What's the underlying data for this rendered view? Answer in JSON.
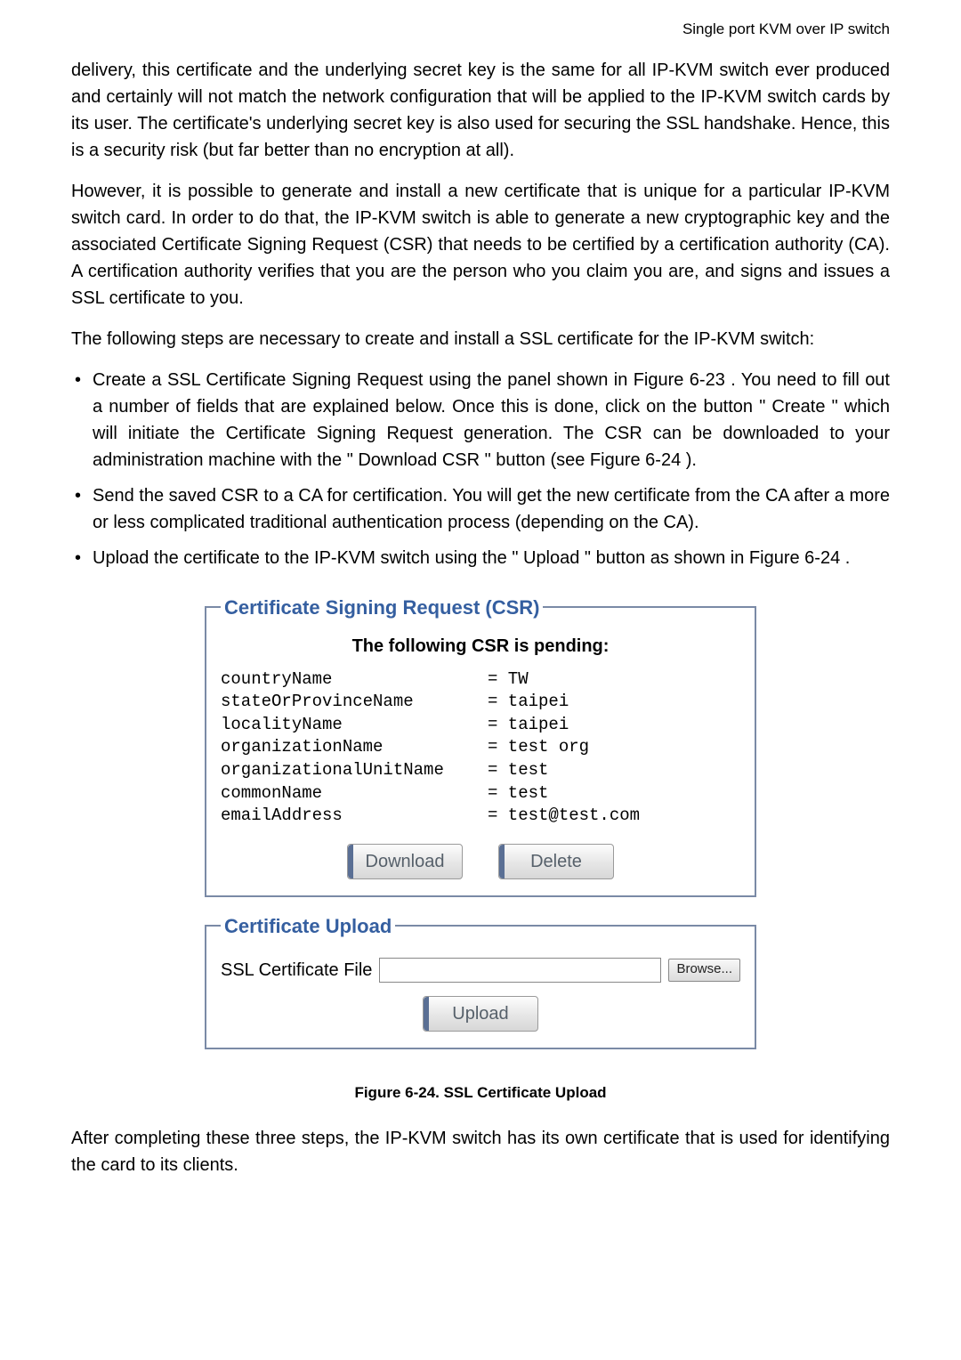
{
  "header": "Single port KVM over IP switch",
  "para1": "delivery, this certificate and the underlying secret key is the same for all IP-KVM switch ever produced and certainly will not match the network configuration that will be applied to the IP-KVM switch cards by its user. The certificate's underlying secret key is also used for securing the SSL handshake. Hence, this is a security risk (but far better than no encryption at all).",
  "para2": "However, it is possible to generate and install a new certificate that is unique for a particular IP-KVM switch card. In order to do that, the IP-KVM switch is able to generate a new cryptographic key and the associated Certificate Signing Request (CSR) that needs to be certified by a certification authority (CA). A certification authority verifies that you are the person who you claim you are, and signs and issues a SSL certificate to you.",
  "para3": "The following steps are necessary to create and install a SSL certificate for the IP-KVM switch:",
  "bullets": [
    "Create a SSL Certificate Signing Request using the panel shown in Figure 6-23 . You need to fill out a number of fields that are explained below. Once this is done, click on the button \" Create \" which will initiate the Certificate Signing Request generation. The CSR can be downloaded to your administration machine with the \" Download CSR \" button (see Figure 6-24 ).",
    "Send the saved CSR to a CA for certification. You will get the new certificate from the CA after a more or less complicated traditional authentication process (depending on the CA).",
    "Upload the certificate to the IP-KVM switch using the \" Upload \" button as shown in Figure 6-24 ."
  ],
  "csr": {
    "legend": "Certificate Signing Request (CSR)",
    "pending_title": "The following CSR is pending:",
    "fields": [
      {
        "key": "countryName",
        "value": "= TW"
      },
      {
        "key": "stateOrProvinceName",
        "value": "= taipei"
      },
      {
        "key": "localityName",
        "value": "= taipei"
      },
      {
        "key": "organizationName",
        "value": "= test org"
      },
      {
        "key": "organizationalUnitName",
        "value": "= test"
      },
      {
        "key": "commonName",
        "value": "= test"
      },
      {
        "key": "emailAddress",
        "value": "= test@test.com"
      }
    ],
    "download_label": "Download",
    "delete_label": "Delete"
  },
  "upload": {
    "legend": "Certificate Upload",
    "file_label": "SSL Certificate File",
    "browse_label": "Browse...",
    "upload_label": "Upload"
  },
  "figure_caption": "Figure 6-24. SSL Certificate Upload",
  "para4": "After completing these three steps, the IP-KVM switch has its own certificate that is used for identifying the card to its clients."
}
